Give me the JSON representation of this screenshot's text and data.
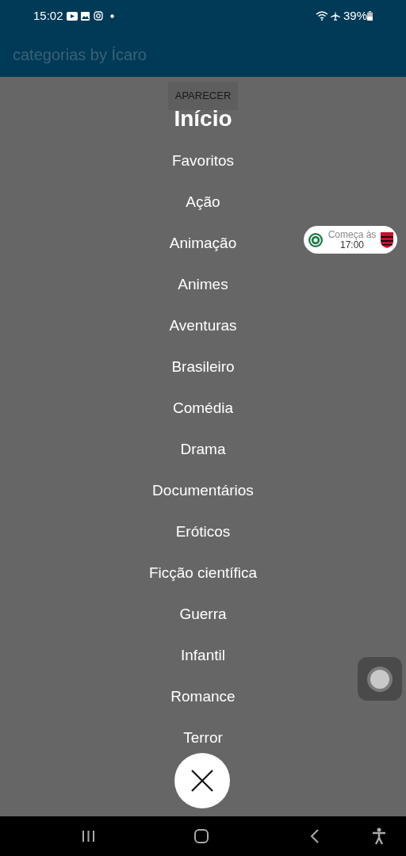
{
  "status_bar": {
    "time": "15:02",
    "battery": "39%"
  },
  "app_bar": {
    "title": "categorias by Ícaro"
  },
  "show_button": {
    "label": "APARECER"
  },
  "menu": {
    "heading": "Início",
    "items": [
      {
        "label": "Favoritos"
      },
      {
        "label": "Ação"
      },
      {
        "label": "Animação"
      },
      {
        "label": "Animes"
      },
      {
        "label": "Aventuras"
      },
      {
        "label": "Brasileiro"
      },
      {
        "label": "Comédia"
      },
      {
        "label": "Drama"
      },
      {
        "label": "Documentários"
      },
      {
        "label": "Eróticos"
      },
      {
        "label": "Ficção científica"
      },
      {
        "label": "Guerra"
      },
      {
        "label": "Infantil"
      },
      {
        "label": "Romance"
      },
      {
        "label": "Terror"
      }
    ]
  },
  "match_widget": {
    "caption": "Começa às",
    "time": "17:00"
  }
}
